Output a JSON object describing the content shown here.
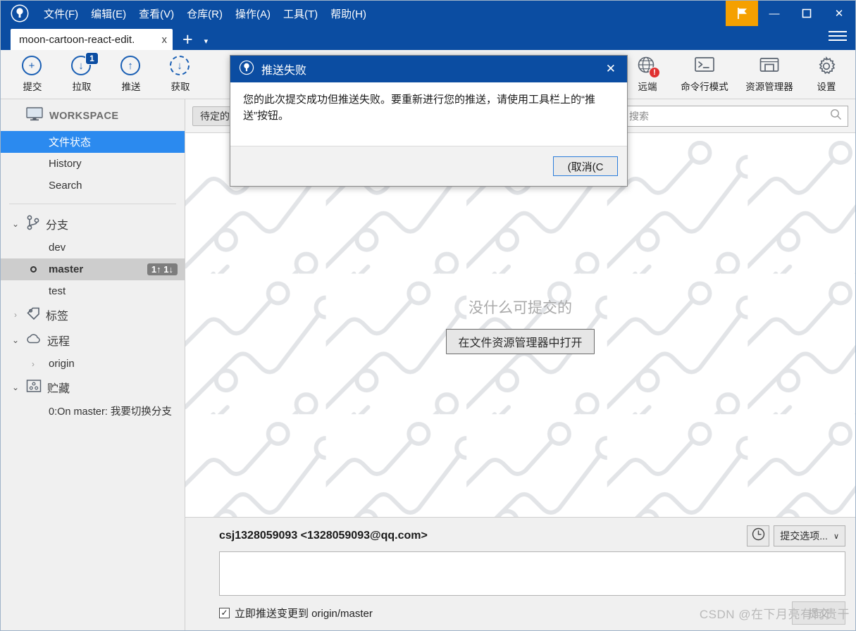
{
  "window": {
    "menu": [
      "文件(F)",
      "编辑(E)",
      "查看(V)",
      "仓库(R)",
      "操作(A)",
      "工具(T)",
      "帮助(H)"
    ],
    "flag_icon": "flag-icon",
    "minimize_glyph": "—",
    "maximize_glyph": "☐",
    "close_glyph": "✕",
    "accent_blue": "#0b4da2",
    "flag_orange": "#f5a000"
  },
  "tabs": {
    "items": [
      {
        "label": "moon-cartoon-react-edit.",
        "close_glyph": "x"
      }
    ],
    "add_glyph": "+",
    "caret_glyph": "▾"
  },
  "toolbar": {
    "left": [
      {
        "label": "提交",
        "icon": "plus-circle-icon",
        "glyph": "+",
        "badge": null,
        "dashed": false
      },
      {
        "label": "拉取",
        "icon": "pull-down-circle-icon",
        "glyph": "↓",
        "badge": "1",
        "dashed": false
      },
      {
        "label": "推送",
        "icon": "push-up-circle-icon",
        "glyph": "↑",
        "badge": null,
        "dashed": false
      },
      {
        "label": "获取",
        "icon": "fetch-dashed-circle-icon",
        "glyph": "↓",
        "badge": null,
        "dashed": true
      }
    ],
    "right": [
      {
        "label": "远端",
        "icon": "globe-icon",
        "error_badge": "!"
      },
      {
        "label": "命令行模式",
        "icon": "terminal-icon",
        "error_badge": null
      },
      {
        "label": "资源管理器",
        "icon": "folder-explorer-icon",
        "error_badge": null
      },
      {
        "label": "设置",
        "icon": "gear-icon",
        "error_badge": null
      }
    ]
  },
  "sidebar": {
    "workspace": {
      "label": "WORKSPACE",
      "icon": "monitor-icon"
    },
    "nav": [
      {
        "label": "文件状态",
        "active": true
      },
      {
        "label": "History",
        "active": false
      },
      {
        "label": "Search",
        "active": false
      }
    ],
    "branches": {
      "title": "分支",
      "icon": "branch-icon",
      "expanded_glyph": "⌄",
      "items": [
        {
          "label": "dev",
          "current": false,
          "badge": null
        },
        {
          "label": "master",
          "current": true,
          "badge": "1↑ 1↓"
        },
        {
          "label": "test",
          "current": false,
          "badge": null
        }
      ]
    },
    "tags": {
      "title": "标签",
      "icon": "tag-icon",
      "collapsed_glyph": "›"
    },
    "remotes": {
      "title": "远程",
      "icon": "cloud-icon",
      "expanded_glyph": "⌄",
      "items": [
        {
          "label": "origin",
          "collapsed_glyph": "›"
        }
      ]
    },
    "stash": {
      "title": "贮藏",
      "icon": "stash-icon",
      "expanded_glyph": "⌄",
      "items": [
        {
          "label": "0:On master: 我要切换分支"
        }
      ]
    }
  },
  "main": {
    "pending_tab": "待定的文",
    "search": {
      "placeholder": "搜索",
      "value": "",
      "icon": "search-icon"
    },
    "empty_message": "没什么可提交的",
    "open_explorer_button": "在文件资源管理器中打开"
  },
  "commit": {
    "author": "csj1328059093 <1328059093@qq.com>",
    "history_icon": "clock-icon",
    "options_label": "提交选项...",
    "options_caret": "∨",
    "message_value": "",
    "message_placeholder": "",
    "push_checkbox": {
      "label": "立即推送变更到 origin/master",
      "checked": true,
      "check_glyph": "✓"
    },
    "commit_button": "提交",
    "watermark": "CSDN @在下月亮有何贵干"
  },
  "dialog": {
    "title": "推送失败",
    "icon": "app-logo-icon",
    "close_glyph": "✕",
    "body": "您的此次提交成功但推送失败。要重新进行您的推送，请使用工具栏上的“推送”按钮。",
    "cancel_button": "(取消(C"
  }
}
